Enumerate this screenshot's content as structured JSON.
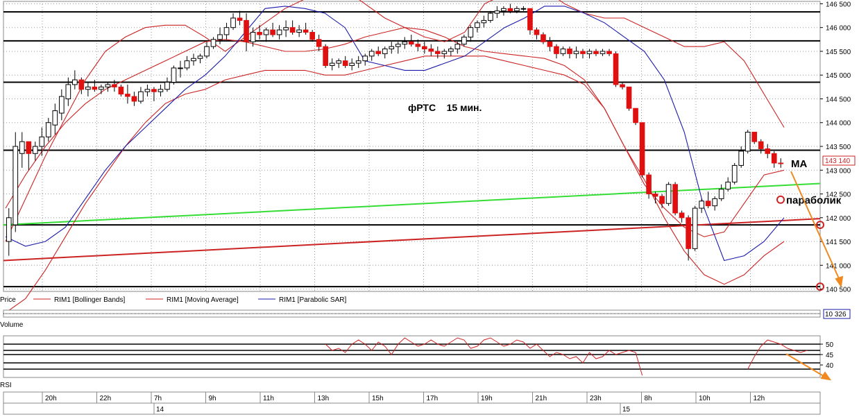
{
  "chart_data": {
    "type": "candlestick",
    "title": "фРТС    15 мин.",
    "price_axis": {
      "ticks": [
        "146 500",
        "146 000",
        "145 500",
        "145 000",
        "144 500",
        "144 000",
        "143 500",
        "143 000",
        "142 500",
        "142 000",
        "141 500",
        "141 000",
        "140 500"
      ],
      "range": [
        140450,
        146550
      ],
      "last_price_label": "143 140",
      "last_price": 143140
    },
    "time_axis": {
      "ticks": [
        "20h",
        "22h",
        "7h",
        "9h",
        "11h",
        "13h",
        "15h",
        "17h",
        "19h",
        "21h",
        "23h",
        "8h",
        "10h",
        "12h"
      ],
      "dates": [
        "14",
        "15"
      ]
    },
    "candles": [
      [
        141500,
        142200,
        141200,
        142000
      ],
      [
        141850,
        143800,
        141700,
        143500
      ],
      [
        143350,
        143800,
        143050,
        143600
      ],
      [
        143600,
        143600,
        143000,
        143350
      ],
      [
        143350,
        143600,
        143200,
        143500
      ],
      [
        143500,
        143900,
        143300,
        143700
      ],
      [
        143700,
        144100,
        143600,
        144000
      ],
      [
        143950,
        144400,
        143750,
        144250
      ],
      [
        144200,
        144700,
        144050,
        144550
      ],
      [
        144500,
        144950,
        144350,
        144800
      ],
      [
        144800,
        145100,
        144700,
        144900
      ],
      [
        144900,
        144950,
        144600,
        144700
      ],
      [
        144700,
        144850,
        144550,
        144750
      ],
      [
        144750,
        144900,
        144650,
        144700
      ],
      [
        144700,
        144800,
        144600,
        144750
      ],
      [
        144750,
        144850,
        144650,
        144800
      ],
      [
        144800,
        144900,
        144650,
        144750
      ],
      [
        144750,
        144800,
        144550,
        144600
      ],
      [
        144600,
        144800,
        144400,
        144550
      ],
      [
        144550,
        144650,
        144350,
        144450
      ],
      [
        144450,
        144750,
        144400,
        144650
      ],
      [
        144650,
        144800,
        144550,
        144700
      ],
      [
        144700,
        144750,
        144450,
        144650
      ],
      [
        144650,
        144800,
        144550,
        144700
      ],
      [
        144700,
        144950,
        144650,
        144850
      ],
      [
        144850,
        145200,
        144800,
        145150
      ],
      [
        145150,
        145300,
        144950,
        145150
      ],
      [
        145150,
        145400,
        145100,
        145300
      ],
      [
        145300,
        145450,
        145200,
        145350
      ],
      [
        145350,
        145450,
        145250,
        145400
      ],
      [
        145400,
        145700,
        145350,
        145600
      ],
      [
        145600,
        145800,
        145550,
        145750
      ],
      [
        145750,
        146000,
        145650,
        145850
      ],
      [
        145850,
        146100,
        145750,
        146000
      ],
      [
        146000,
        146300,
        145950,
        146200
      ],
      [
        146200,
        146350,
        146050,
        146150
      ],
      [
        146150,
        146300,
        145500,
        145700
      ],
      [
        145700,
        146000,
        145600,
        145900
      ],
      [
        145900,
        146050,
        145750,
        145850
      ],
      [
        145850,
        146000,
        145700,
        145950
      ],
      [
        145950,
        146100,
        145800,
        145850
      ],
      [
        145850,
        146050,
        145750,
        145950
      ],
      [
        145950,
        146150,
        145800,
        146000
      ],
      [
        146000,
        146150,
        145850,
        145900
      ],
      [
        145900,
        146050,
        145800,
        145950
      ],
      [
        145950,
        146100,
        145850,
        145900
      ],
      [
        145900,
        145950,
        145700,
        145750
      ],
      [
        145750,
        145850,
        145500,
        145600
      ],
      [
        145600,
        145650,
        145150,
        145200
      ],
      [
        145200,
        145350,
        145100,
        145250
      ],
      [
        145250,
        145350,
        145150,
        145300
      ],
      [
        145300,
        145400,
        145150,
        145200
      ],
      [
        145200,
        145350,
        145100,
        145250
      ],
      [
        145250,
        145400,
        145150,
        145300
      ],
      [
        145300,
        145450,
        145200,
        145400
      ],
      [
        145400,
        145550,
        145300,
        145500
      ],
      [
        145500,
        145600,
        145400,
        145450
      ],
      [
        145450,
        145600,
        145350,
        145550
      ],
      [
        145550,
        145700,
        145450,
        145600
      ],
      [
        145600,
        145700,
        145450,
        145650
      ],
      [
        145650,
        145800,
        145550,
        145700
      ],
      [
        145700,
        145850,
        145600,
        145650
      ],
      [
        145650,
        145750,
        145500,
        145600
      ],
      [
        145600,
        145700,
        145450,
        145550
      ],
      [
        145550,
        145650,
        145400,
        145500
      ],
      [
        145500,
        145600,
        145350,
        145450
      ],
      [
        145450,
        145550,
        145350,
        145500
      ],
      [
        145500,
        145600,
        145400,
        145550
      ],
      [
        145550,
        145700,
        145450,
        145650
      ],
      [
        145650,
        145850,
        145600,
        145800
      ],
      [
        145800,
        146050,
        145700,
        146000
      ],
      [
        146000,
        146150,
        145900,
        146100
      ],
      [
        146100,
        146250,
        146000,
        146150
      ],
      [
        146150,
        146350,
        146100,
        146300
      ],
      [
        146300,
        146450,
        146200,
        146350
      ],
      [
        146350,
        146450,
        146250,
        146400
      ],
      [
        146400,
        146500,
        146300,
        146350
      ],
      [
        146350,
        146450,
        146300,
        146400
      ],
      [
        146400,
        146450,
        146350,
        146400
      ],
      [
        146400,
        146400,
        145850,
        145950
      ],
      [
        145950,
        146000,
        145750,
        145850
      ],
      [
        145850,
        145900,
        145650,
        145700
      ],
      [
        145700,
        145800,
        145500,
        145600
      ],
      [
        145600,
        145650,
        145350,
        145450
      ],
      [
        145450,
        145600,
        145400,
        145550
      ],
      [
        145550,
        145600,
        145350,
        145450
      ],
      [
        145450,
        145600,
        145350,
        145500
      ],
      [
        145500,
        145550,
        145350,
        145450
      ],
      [
        145450,
        145550,
        145350,
        145500
      ],
      [
        145500,
        145550,
        145400,
        145450
      ],
      [
        145450,
        145550,
        145400,
        145500
      ],
      [
        145500,
        145550,
        145400,
        145450
      ],
      [
        145450,
        145500,
        144750,
        144800
      ],
      [
        144800,
        144850,
        144700,
        144750
      ],
      [
        144750,
        144750,
        144250,
        144300
      ],
      [
        144300,
        144300,
        143950,
        144000
      ],
      [
        144000,
        144000,
        142850,
        142900
      ],
      [
        142900,
        142950,
        142400,
        142500
      ],
      [
        142500,
        142550,
        142300,
        142450
      ],
      [
        142450,
        142500,
        142200,
        142300
      ],
      [
        142300,
        142750,
        142250,
        142700
      ],
      [
        142700,
        142750,
        142050,
        142100
      ],
      [
        142100,
        142150,
        141900,
        142000
      ],
      [
        142000,
        142050,
        141100,
        141350
      ],
      [
        141350,
        142250,
        141300,
        142200
      ],
      [
        142200,
        142400,
        142100,
        142350
      ],
      [
        142350,
        142550,
        142200,
        142250
      ],
      [
        142250,
        142450,
        142150,
        142400
      ],
      [
        142400,
        142700,
        142350,
        142600
      ],
      [
        142600,
        142850,
        142550,
        142750
      ],
      [
        142750,
        143150,
        142700,
        143100
      ],
      [
        143100,
        143500,
        143050,
        143400
      ],
      [
        143400,
        143850,
        143350,
        143800
      ],
      [
        143800,
        143800,
        143550,
        143600
      ],
      [
        143600,
        143650,
        143350,
        143450
      ],
      [
        143450,
        143550,
        143250,
        143350
      ],
      [
        143350,
        143400,
        143050,
        143150
      ],
      [
        143150,
        143250,
        143050,
        143140
      ]
    ],
    "lines": [
      {
        "name": "green trend line",
        "color": "#33dd33",
        "from": [
          0,
          141850
        ],
        "to": [
          1,
          142720
        ]
      },
      {
        "name": "red trend line",
        "color": "#cc2222",
        "from": [
          0,
          141100
        ],
        "to": [
          1,
          141980
        ]
      },
      {
        "name": "horizontal levels",
        "color": "#000000",
        "values": [
          146330,
          145720,
          144850,
          143420,
          141850,
          140550
        ]
      }
    ],
    "indicators": {
      "bollinger_upper": [
        141500,
        142400,
        143300,
        144100,
        144900,
        145500,
        145800,
        146000,
        146050,
        146050,
        145800,
        145500,
        145800,
        146100,
        146400,
        146600,
        146800,
        146800,
        146500,
        146200,
        146000,
        145800,
        145700,
        145900,
        146500,
        146700,
        146800,
        146800,
        146500,
        146300,
        146200,
        146200,
        146000,
        145800,
        145600,
        145600,
        145700,
        145300,
        144600,
        143900
      ],
      "bollinger_lower": [
        140000,
        140300,
        140900,
        141600,
        142300,
        142900,
        143500,
        144000,
        144400,
        144600,
        144700,
        144900,
        145000,
        145100,
        145100,
        145100,
        145000,
        145000,
        145100,
        145200,
        145300,
        145400,
        145400,
        145400,
        145400,
        145300,
        145200,
        145100,
        145000,
        144800,
        144300,
        143500,
        142800,
        142000,
        141300,
        140800,
        140600,
        140800,
        141200,
        141500
      ],
      "moving_average": [
        142200,
        142900,
        143500,
        144000,
        144400,
        144700,
        144900,
        145100,
        145300,
        145500,
        145700,
        145750,
        145700,
        145600,
        145500,
        145500,
        145550,
        145650,
        145800,
        145900,
        146000,
        145950,
        145800,
        145600,
        145500,
        145450,
        145400,
        145350,
        145200,
        144900,
        144300,
        143500,
        142700,
        142200,
        141800,
        141600,
        141700,
        142300,
        142900,
        143000
      ],
      "parabolic_sar": [
        141600,
        141400,
        141500,
        141800,
        142400,
        143000,
        143500,
        143900,
        144300,
        144700,
        145000,
        145400,
        145900,
        146400,
        146450,
        146400,
        146300,
        146000,
        145300,
        145200,
        145100,
        145100,
        145250,
        145400,
        145700,
        146000,
        146200,
        146450,
        146450,
        146300,
        146100,
        145800,
        145500,
        144900,
        143800,
        142200,
        141100,
        141200,
        141500,
        142000
      ]
    },
    "annotations": [
      {
        "text": "MA",
        "at": [
          0.93,
          143120
        ]
      },
      {
        "text": "параболик",
        "at": [
          0.9,
          142380
        ]
      }
    ],
    "volume": {
      "label": "Volume",
      "last": "10 326"
    },
    "rsi": {
      "label": "RSI",
      "ticks": [
        "50",
        "45",
        "40"
      ],
      "levels": [
        50,
        47,
        45,
        41,
        38
      ]
    },
    "legend": [
      {
        "label": "Price",
        "color": "#000000"
      },
      {
        "label": "RIM1 [Bollinger Bands]",
        "color": "#cc2222"
      },
      {
        "label": "RIM1 [Moving Average]",
        "color": "#cc2222"
      },
      {
        "label": "RIM1 [Parabolic SAR]",
        "color": "#1a1aaa"
      }
    ]
  }
}
